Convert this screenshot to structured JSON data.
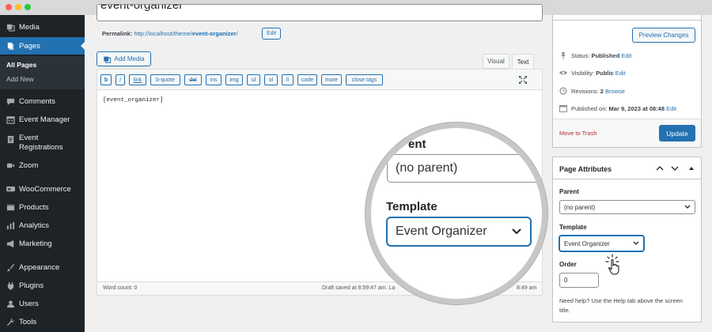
{
  "window": {
    "dots": [
      "#ff5f57",
      "#febc2e",
      "#28c840"
    ]
  },
  "sidebar": {
    "items": [
      {
        "label": "Media",
        "icon": "media-icon"
      },
      {
        "label": "Pages",
        "icon": "pages-icon",
        "active": true
      },
      {
        "label": "Comments",
        "icon": "comments-icon"
      },
      {
        "label": "Event Manager",
        "icon": "calendar-icon"
      },
      {
        "label": "Event Registrations",
        "icon": "registrations-icon"
      },
      {
        "label": "Zoom",
        "icon": "video-icon"
      },
      {
        "label": "WooCommerce",
        "icon": "woocommerce-icon"
      },
      {
        "label": "Products",
        "icon": "products-icon"
      },
      {
        "label": "Analytics",
        "icon": "analytics-icon"
      },
      {
        "label": "Marketing",
        "icon": "megaphone-icon"
      },
      {
        "label": "Appearance",
        "icon": "paintbrush-icon"
      },
      {
        "label": "Plugins",
        "icon": "plugin-icon"
      },
      {
        "label": "Users",
        "icon": "users-icon"
      },
      {
        "label": "Tools",
        "icon": "wrench-icon"
      }
    ],
    "submenu": [
      "All Pages",
      "Add New"
    ]
  },
  "editor": {
    "title_value": "event-organizer",
    "permalink_label": "Permalink:",
    "permalink_base": "http://localhost/theme/",
    "permalink_slug": "event-organizer",
    "permalink_trail": "/",
    "edit_label": "Edit",
    "add_media": "Add Media",
    "tabs": [
      "Visual",
      "Text"
    ],
    "quicktags": [
      "b",
      "i",
      "link",
      "b-quote",
      "del",
      "ins",
      "img",
      "ul",
      "ol",
      "li",
      "code",
      "more",
      "close tags"
    ],
    "content": "[event_organizer]",
    "word_count": "Word count: 0",
    "draft_saved": "Draft saved at 8:59:47 am. La",
    "draft_time_tail": "8:49 am"
  },
  "publish": {
    "preview_button": "Preview Changes",
    "rows": [
      {
        "icon": "pin-icon",
        "label": "Status: ",
        "value": "Published",
        "link": "Edit"
      },
      {
        "icon": "eye-icon",
        "label": "Visibility: ",
        "value": "Public",
        "link": "Edit"
      },
      {
        "icon": "revisions-icon",
        "label": "Revisions: ",
        "value": "2",
        "link": "Browse"
      },
      {
        "icon": "calendar-icon",
        "label": "Published on: ",
        "value": "Mar 9, 2023 at 08:48",
        "link": "Edit"
      }
    ],
    "trash": "Move to Trash",
    "update": "Update"
  },
  "page_attributes": {
    "title": "Page Attributes",
    "parent_label": "Parent",
    "parent_value": "(no parent)",
    "template_label": "Template",
    "template_value": "Event Organizer",
    "order_label": "Order",
    "order_value": "0",
    "help": "Need help? Use the Help tab above the screen title."
  },
  "magnifier": {
    "parent_label_partial": "ent",
    "parent_value": "(no parent)",
    "template_label": "Template",
    "template_value": "Event Organizer"
  },
  "colors": {
    "accent": "#2271b1",
    "sidebar": "#1d2327",
    "trash": "#b32d2e"
  }
}
